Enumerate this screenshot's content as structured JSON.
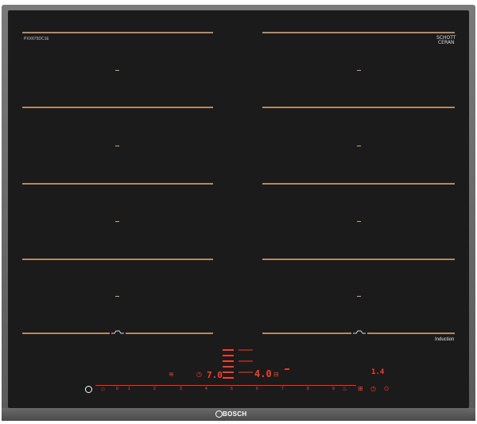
{
  "cooktop": {
    "model": "PXX675DC1E",
    "glass_brand_line1": "SCHOTT",
    "glass_brand_line2": "CERAN",
    "glass_brand_line3": "",
    "induction_label": "Induction",
    "brand": "BOSCH",
    "colors": {
      "glass": "#1b1b1b",
      "zone_lines": "#b08a66",
      "display_red": "#ff3b2a",
      "frame": "#6a6a6a"
    }
  },
  "controls": {
    "left_display": "7.0",
    "center_display": "4.0",
    "right_display": "1.4",
    "slider_numbers": [
      "0",
      "1",
      "2",
      "3",
      "4",
      "5",
      "6",
      "7",
      "8",
      "9"
    ],
    "icons": [
      "power-icon",
      "child-lock-icon",
      "pan-icon",
      "timer-icon",
      "clock-icon",
      "wipe-icon",
      "fry-icon"
    ]
  }
}
